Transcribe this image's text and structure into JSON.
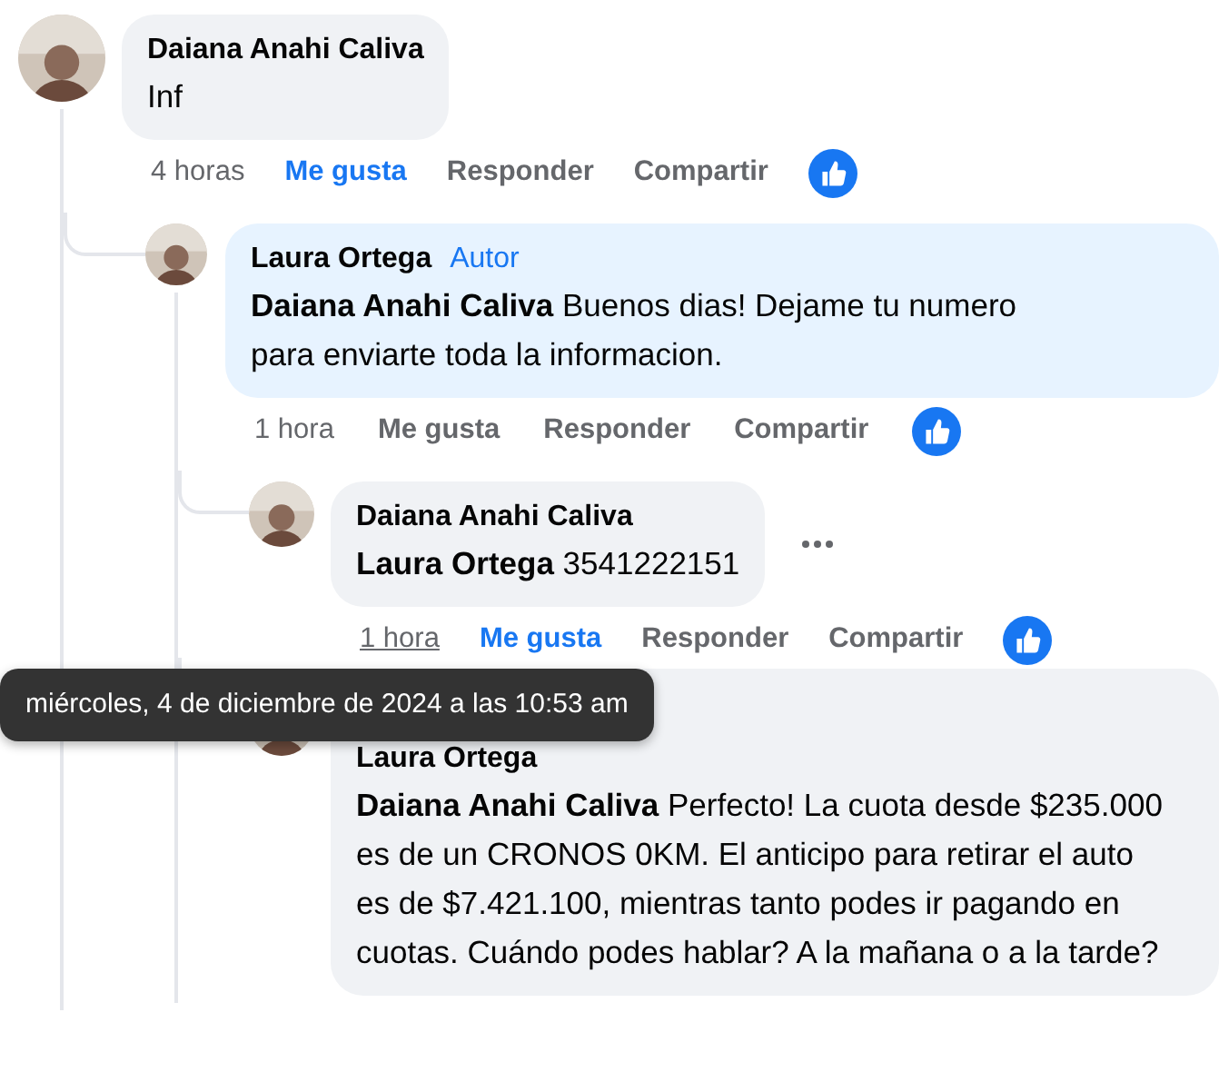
{
  "comments": [
    {
      "author": "Daiana Anahi Caliva",
      "text": "Inf",
      "highlighted": false,
      "actions": {
        "time": "4 horas",
        "time_hovered": false,
        "like": "Me gusta",
        "liked": true,
        "reply": "Responder",
        "share": "Compartir"
      },
      "reaction": true,
      "more_button": false,
      "children": [
        {
          "author": "Laura Ortega",
          "badge": "Autor",
          "text": "**Daiana Anahi Caliva** Buenos dias! Dejame tu numero para enviarte toda la informacion.",
          "highlighted": true,
          "actions": {
            "time": "1 hora",
            "time_hovered": false,
            "like": "Me gusta",
            "liked": false,
            "reply": "Responder",
            "share": "Compartir"
          },
          "reaction": true,
          "more_button": false,
          "children": [
            {
              "author": "Daiana Anahi Caliva",
              "text": "**Laura Ortega** 3541222151",
              "highlighted": false,
              "actions": {
                "time": "1 hora",
                "time_hovered": true,
                "like": "Me gusta",
                "liked": true,
                "reply": "Responder",
                "share": "Compartir"
              },
              "reaction": true,
              "more_button": true
            },
            {
              "author": "Laura Ortega",
              "text": "**Daiana Anahi Caliva** Perfecto! La cuota desde $235.000 es de un CRONOS 0KM. El anticipo para retirar el auto es de $7.421.100, mientras tanto podes ir pagando en cuotas. Cuándo podes hablar? A la mañana o a la tarde?",
              "highlighted": false
            }
          ]
        }
      ]
    }
  ],
  "tooltip": {
    "text": "miércoles, 4 de diciembre de 2024 a las 10:53 am"
  }
}
